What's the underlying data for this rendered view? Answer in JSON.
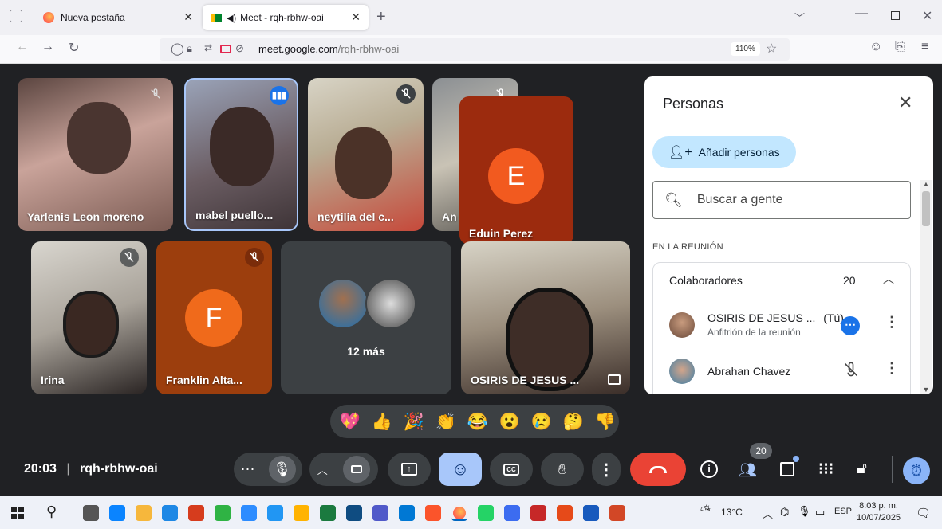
{
  "browser": {
    "tabs": [
      {
        "label": "Nueva pestaña"
      },
      {
        "label": "Meet - rqh-rbhw-oai"
      }
    ],
    "url_domain": "meet.google.com",
    "url_path": "/rqh-rbhw-oai",
    "zoom": "110%"
  },
  "tiles": [
    {
      "name": "Yarlenis Leon moreno"
    },
    {
      "name": "mabel puello..."
    },
    {
      "name": "neytilia del c..."
    },
    {
      "name": "An"
    },
    {
      "name": "Eduin Perez",
      "initial": "E"
    },
    {
      "name": "Irina"
    },
    {
      "name": "Franklin Alta...",
      "initial": "F"
    },
    {
      "more": "12 más"
    },
    {
      "name": "OSIRIS DE JESUS ..."
    }
  ],
  "reactions": [
    "💖",
    "👍",
    "🎉",
    "👏",
    "😂",
    "😮",
    "😢",
    "🤔",
    "👎"
  ],
  "meeting": {
    "time": "20:03",
    "code": "rqh-rbhw-oai",
    "participant_badge": "20"
  },
  "panel": {
    "title": "Personas",
    "add_button": "Añadir personas",
    "search_placeholder": "Buscar a gente",
    "section": "EN LA REUNIÓN",
    "group": {
      "label": "Colaboradores",
      "count": "20"
    },
    "people": [
      {
        "name": "OSIRIS DE JESUS ...",
        "you": "(Tú)",
        "role": "Anfitrión de la reunión"
      },
      {
        "name": "Abrahan Chavez"
      }
    ]
  },
  "taskbar": {
    "weather": "13°C",
    "lang": "ESP",
    "clock_time": "8:03 p. m.",
    "clock_date": "10/07/2025"
  },
  "colors": {
    "accent": "#1a73e8",
    "end_call": "#ea4335",
    "orange_avatar": "#e8541e"
  }
}
